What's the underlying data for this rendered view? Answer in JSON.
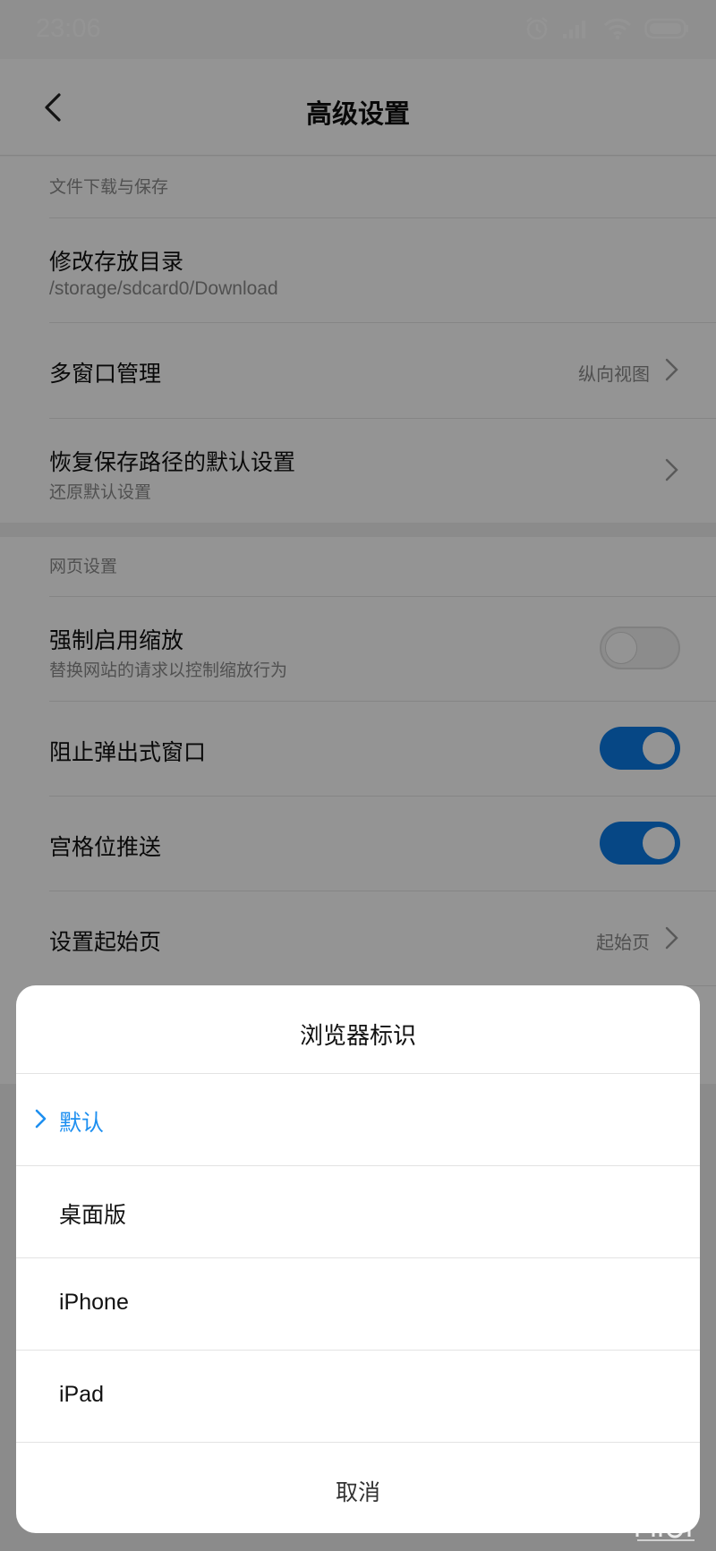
{
  "status_bar": {
    "time": "23:06",
    "icons": [
      "alarm-icon",
      "signal-icon",
      "wifi-icon",
      "battery-icon"
    ]
  },
  "header": {
    "title": "高级设置",
    "back_icon": "back-arrow-icon"
  },
  "sections": {
    "download": {
      "header": "文件下载与保存",
      "change_dir": {
        "label": "修改存放目录",
        "sub": "/storage/sdcard0/Download"
      },
      "multi_window": {
        "label": "多窗口管理",
        "value": "纵向视图"
      },
      "restore_path": {
        "label": "恢复保存路径的默认设置",
        "sub": "还原默认设置"
      }
    },
    "web": {
      "header": "网页设置",
      "force_zoom": {
        "label": "强制启用缩放",
        "sub": "替换网站的请求以控制缩放行为",
        "enabled": false
      },
      "block_popups": {
        "label": "阻止弹出式窗口",
        "enabled": true
      },
      "palace_push": {
        "label": "宫格位推送",
        "enabled": true
      },
      "start_page": {
        "label": "设置起始页",
        "value": "起始页"
      }
    }
  },
  "dialog": {
    "title": "浏览器标识",
    "options": [
      {
        "label": "默认",
        "selected": true
      },
      {
        "label": "桌面版",
        "selected": false
      },
      {
        "label": "iPhone",
        "selected": false
      },
      {
        "label": "iPad",
        "selected": false
      }
    ],
    "cancel_label": "取消"
  },
  "watermark": "MIUI",
  "colors": {
    "accent": "#0b7ae6",
    "selected_text": "#1d8ff0",
    "secondary_text": "#8a8a8a"
  }
}
